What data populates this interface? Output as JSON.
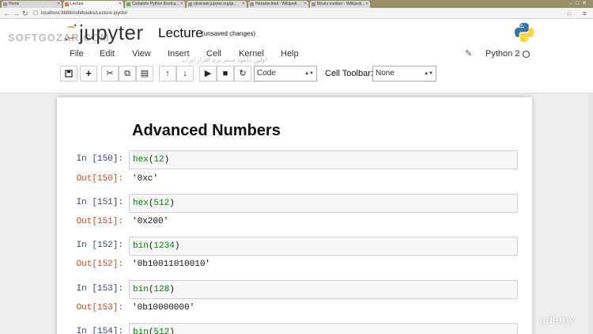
{
  "browser": {
    "tabs": [
      {
        "label": "Home",
        "active": false
      },
      {
        "label": "Lecture",
        "active": true
      },
      {
        "label": "Complete Python Bootca...",
        "active": false
      },
      {
        "label": "nbviewer.jupyter.org/gi...",
        "active": false
      },
      {
        "label": "Hexadecimal - Wikipedi...",
        "active": false
      },
      {
        "label": "Binary number - Wikipedi...",
        "active": false
      }
    ],
    "url": "localhost:8888/notebooks/Lecture.ipynb#"
  },
  "header": {
    "logo_text": "jupyter",
    "notebook_title": "Lecture",
    "save_status": "(unsaved changes)",
    "watermark": "SOFTGOZAR.COM",
    "watermark_sub": "اولین دانلود سنتر نرم افزار ایران"
  },
  "menubar": {
    "items": [
      "File",
      "Edit",
      "View",
      "Insert",
      "Cell",
      "Kernel",
      "Help"
    ],
    "kernel_name": "Python 2"
  },
  "toolbar": {
    "cell_type": "Code",
    "cell_toolbar_label": "Cell Toolbar:",
    "cell_toolbar_value": "None"
  },
  "notebook": {
    "heading": "Advanced Numbers",
    "cells": [
      {
        "in_prompt": "In [150]:",
        "fn": "hex",
        "arg": "12",
        "out_prompt": "Out[150]:",
        "output": "'0xc'"
      },
      {
        "in_prompt": "In [151]:",
        "fn": "hex",
        "arg": "512",
        "out_prompt": "Out[151]:",
        "output": "'0x200'"
      },
      {
        "in_prompt": "In [152]:",
        "fn": "bin",
        "arg": "1234",
        "out_prompt": "Out[152]:",
        "output": "'0b10011010010'"
      },
      {
        "in_prompt": "In [153]:",
        "fn": "bin",
        "arg": "128",
        "out_prompt": "Out[153]:",
        "output": "'0b10000000'"
      },
      {
        "in_prompt": "In [154]:",
        "fn": "bin",
        "arg": "512",
        "out_prompt": "",
        "output": ""
      }
    ]
  },
  "overlay": {
    "brand": "udemy"
  },
  "colors": {
    "in_prompt": "#303f9f",
    "out_prompt": "#d84315",
    "code_builtin": "#008000"
  }
}
